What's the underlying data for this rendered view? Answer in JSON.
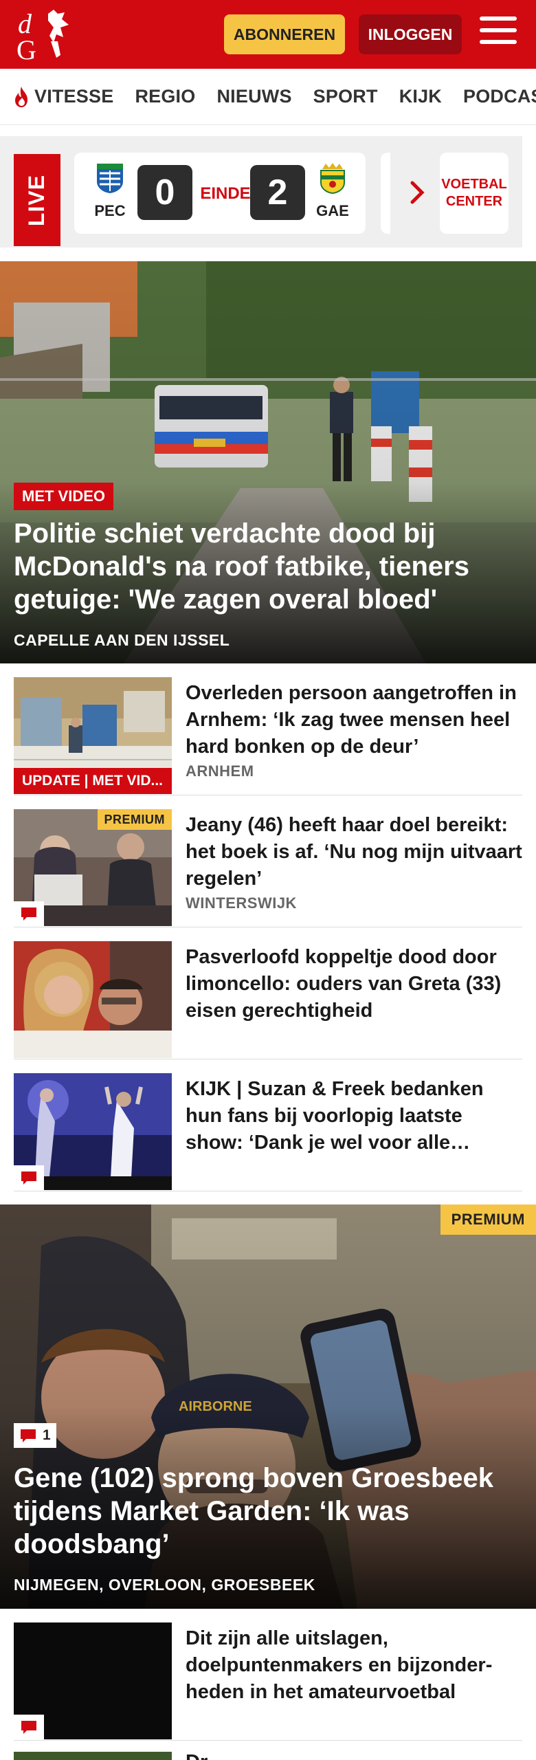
{
  "header": {
    "logo_text": "dG",
    "subscribe_label": "ABONNEREN",
    "login_label": "INLOGGEN",
    "brand_color": "#d10a11"
  },
  "nav": {
    "items": [
      {
        "label": "VITESSE",
        "icon": "flame-icon"
      },
      {
        "label": "REGIO"
      },
      {
        "label": "NIEUWS"
      },
      {
        "label": "SPORT"
      },
      {
        "label": "KIJK"
      },
      {
        "label": "PODCAST"
      }
    ]
  },
  "live": {
    "label": "LIVE",
    "match": {
      "home_team": "PEC",
      "home_score": "0",
      "status": "EINDE",
      "away_score": "2",
      "away_team": "GAE"
    },
    "voetbal_center_label": "VOETBAL CENTER"
  },
  "hero": {
    "badge": "MET VIDEO",
    "title": "Politie schiet verdachte dood bij McDonald's na roof fatbike, tieners getuige: 'We zagen overal bloed'",
    "location": "CAPELLE AAN DEN IJSSEL"
  },
  "articles": [
    {
      "title": "Overleden persoon aangetroffen in Arnhem: ‘Ik zag twee mensen heel hard bonken op de deur’",
      "location": "ARNHEM",
      "badge": "UPDATE | MET VID..."
    },
    {
      "title": "Jeany (46) heeft haar doel bereikt: het boek is af. ‘Nu nog mijn uitvaart regelen’",
      "location": "WINTERSWIJK",
      "premium": "PREMIUM"
    },
    {
      "title": "Pasverloofd koppeltje dood door limoncello: ouders van Greta (33) eisen gerechtigheid",
      "location": ""
    },
    {
      "title": "KIJK | Suzan & Freek bedanken hun fans bij voorlopig laatste show: ‘Dank je wel voor alle…",
      "location": ""
    }
  ],
  "big": {
    "premium": "PREMIUM",
    "comment_count": "1",
    "title": "Gene (102) sprong boven Groesbeek tijdens Market Garden: ‘Ik was doodsbang’",
    "location": "NIJMEGEN, OVERLOON, GROESBEEK"
  },
  "bottom_article": {
    "title": "Dit zijn alle uitslagen, doelpuntenmakers en bijzonder­heden in het amateurvoetbal"
  },
  "next_article_partial": {
    "title": "Dr..."
  }
}
